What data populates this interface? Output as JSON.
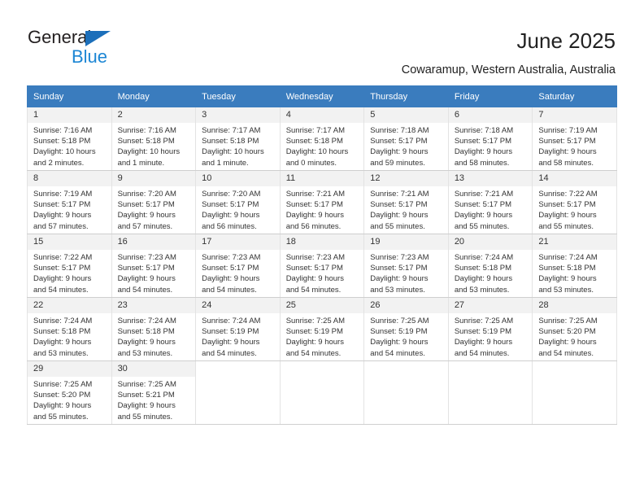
{
  "brand": {
    "name_part1": "General",
    "name_part2": "Blue",
    "triangle_color": "#1c6fba",
    "blue_text_color": "#1c86d4"
  },
  "header": {
    "title": "June 2025",
    "subtitle": "Cowaramup, Western Australia, Australia"
  },
  "theme": {
    "header_row_bg": "#3a7cbe",
    "header_row_text": "#ffffff",
    "daynum_bg": "#f2f2f2",
    "cell_border": "#e3e3e3"
  },
  "weekday_headers": [
    "Sunday",
    "Monday",
    "Tuesday",
    "Wednesday",
    "Thursday",
    "Friday",
    "Saturday"
  ],
  "weeks": [
    [
      {
        "day": "1",
        "sunrise": "Sunrise: 7:16 AM",
        "sunset": "Sunset: 5:18 PM",
        "daylight_line1": "Daylight: 10 hours",
        "daylight_line2": "and 2 minutes."
      },
      {
        "day": "2",
        "sunrise": "Sunrise: 7:16 AM",
        "sunset": "Sunset: 5:18 PM",
        "daylight_line1": "Daylight: 10 hours",
        "daylight_line2": "and 1 minute."
      },
      {
        "day": "3",
        "sunrise": "Sunrise: 7:17 AM",
        "sunset": "Sunset: 5:18 PM",
        "daylight_line1": "Daylight: 10 hours",
        "daylight_line2": "and 1 minute."
      },
      {
        "day": "4",
        "sunrise": "Sunrise: 7:17 AM",
        "sunset": "Sunset: 5:18 PM",
        "daylight_line1": "Daylight: 10 hours",
        "daylight_line2": "and 0 minutes."
      },
      {
        "day": "5",
        "sunrise": "Sunrise: 7:18 AM",
        "sunset": "Sunset: 5:17 PM",
        "daylight_line1": "Daylight: 9 hours",
        "daylight_line2": "and 59 minutes."
      },
      {
        "day": "6",
        "sunrise": "Sunrise: 7:18 AM",
        "sunset": "Sunset: 5:17 PM",
        "daylight_line1": "Daylight: 9 hours",
        "daylight_line2": "and 58 minutes."
      },
      {
        "day": "7",
        "sunrise": "Sunrise: 7:19 AM",
        "sunset": "Sunset: 5:17 PM",
        "daylight_line1": "Daylight: 9 hours",
        "daylight_line2": "and 58 minutes."
      }
    ],
    [
      {
        "day": "8",
        "sunrise": "Sunrise: 7:19 AM",
        "sunset": "Sunset: 5:17 PM",
        "daylight_line1": "Daylight: 9 hours",
        "daylight_line2": "and 57 minutes."
      },
      {
        "day": "9",
        "sunrise": "Sunrise: 7:20 AM",
        "sunset": "Sunset: 5:17 PM",
        "daylight_line1": "Daylight: 9 hours",
        "daylight_line2": "and 57 minutes."
      },
      {
        "day": "10",
        "sunrise": "Sunrise: 7:20 AM",
        "sunset": "Sunset: 5:17 PM",
        "daylight_line1": "Daylight: 9 hours",
        "daylight_line2": "and 56 minutes."
      },
      {
        "day": "11",
        "sunrise": "Sunrise: 7:21 AM",
        "sunset": "Sunset: 5:17 PM",
        "daylight_line1": "Daylight: 9 hours",
        "daylight_line2": "and 56 minutes."
      },
      {
        "day": "12",
        "sunrise": "Sunrise: 7:21 AM",
        "sunset": "Sunset: 5:17 PM",
        "daylight_line1": "Daylight: 9 hours",
        "daylight_line2": "and 55 minutes."
      },
      {
        "day": "13",
        "sunrise": "Sunrise: 7:21 AM",
        "sunset": "Sunset: 5:17 PM",
        "daylight_line1": "Daylight: 9 hours",
        "daylight_line2": "and 55 minutes."
      },
      {
        "day": "14",
        "sunrise": "Sunrise: 7:22 AM",
        "sunset": "Sunset: 5:17 PM",
        "daylight_line1": "Daylight: 9 hours",
        "daylight_line2": "and 55 minutes."
      }
    ],
    [
      {
        "day": "15",
        "sunrise": "Sunrise: 7:22 AM",
        "sunset": "Sunset: 5:17 PM",
        "daylight_line1": "Daylight: 9 hours",
        "daylight_line2": "and 54 minutes."
      },
      {
        "day": "16",
        "sunrise": "Sunrise: 7:23 AM",
        "sunset": "Sunset: 5:17 PM",
        "daylight_line1": "Daylight: 9 hours",
        "daylight_line2": "and 54 minutes."
      },
      {
        "day": "17",
        "sunrise": "Sunrise: 7:23 AM",
        "sunset": "Sunset: 5:17 PM",
        "daylight_line1": "Daylight: 9 hours",
        "daylight_line2": "and 54 minutes."
      },
      {
        "day": "18",
        "sunrise": "Sunrise: 7:23 AM",
        "sunset": "Sunset: 5:17 PM",
        "daylight_line1": "Daylight: 9 hours",
        "daylight_line2": "and 54 minutes."
      },
      {
        "day": "19",
        "sunrise": "Sunrise: 7:23 AM",
        "sunset": "Sunset: 5:17 PM",
        "daylight_line1": "Daylight: 9 hours",
        "daylight_line2": "and 53 minutes."
      },
      {
        "day": "20",
        "sunrise": "Sunrise: 7:24 AM",
        "sunset": "Sunset: 5:18 PM",
        "daylight_line1": "Daylight: 9 hours",
        "daylight_line2": "and 53 minutes."
      },
      {
        "day": "21",
        "sunrise": "Sunrise: 7:24 AM",
        "sunset": "Sunset: 5:18 PM",
        "daylight_line1": "Daylight: 9 hours",
        "daylight_line2": "and 53 minutes."
      }
    ],
    [
      {
        "day": "22",
        "sunrise": "Sunrise: 7:24 AM",
        "sunset": "Sunset: 5:18 PM",
        "daylight_line1": "Daylight: 9 hours",
        "daylight_line2": "and 53 minutes."
      },
      {
        "day": "23",
        "sunrise": "Sunrise: 7:24 AM",
        "sunset": "Sunset: 5:18 PM",
        "daylight_line1": "Daylight: 9 hours",
        "daylight_line2": "and 53 minutes."
      },
      {
        "day": "24",
        "sunrise": "Sunrise: 7:24 AM",
        "sunset": "Sunset: 5:19 PM",
        "daylight_line1": "Daylight: 9 hours",
        "daylight_line2": "and 54 minutes."
      },
      {
        "day": "25",
        "sunrise": "Sunrise: 7:25 AM",
        "sunset": "Sunset: 5:19 PM",
        "daylight_line1": "Daylight: 9 hours",
        "daylight_line2": "and 54 minutes."
      },
      {
        "day": "26",
        "sunrise": "Sunrise: 7:25 AM",
        "sunset": "Sunset: 5:19 PM",
        "daylight_line1": "Daylight: 9 hours",
        "daylight_line2": "and 54 minutes."
      },
      {
        "day": "27",
        "sunrise": "Sunrise: 7:25 AM",
        "sunset": "Sunset: 5:19 PM",
        "daylight_line1": "Daylight: 9 hours",
        "daylight_line2": "and 54 minutes."
      },
      {
        "day": "28",
        "sunrise": "Sunrise: 7:25 AM",
        "sunset": "Sunset: 5:20 PM",
        "daylight_line1": "Daylight: 9 hours",
        "daylight_line2": "and 54 minutes."
      }
    ],
    [
      {
        "day": "29",
        "sunrise": "Sunrise: 7:25 AM",
        "sunset": "Sunset: 5:20 PM",
        "daylight_line1": "Daylight: 9 hours",
        "daylight_line2": "and 55 minutes."
      },
      {
        "day": "30",
        "sunrise": "Sunrise: 7:25 AM",
        "sunset": "Sunset: 5:21 PM",
        "daylight_line1": "Daylight: 9 hours",
        "daylight_line2": "and 55 minutes."
      },
      {
        "day": "",
        "sunrise": "",
        "sunset": "",
        "daylight_line1": "",
        "daylight_line2": ""
      },
      {
        "day": "",
        "sunrise": "",
        "sunset": "",
        "daylight_line1": "",
        "daylight_line2": ""
      },
      {
        "day": "",
        "sunrise": "",
        "sunset": "",
        "daylight_line1": "",
        "daylight_line2": ""
      },
      {
        "day": "",
        "sunrise": "",
        "sunset": "",
        "daylight_line1": "",
        "daylight_line2": ""
      },
      {
        "day": "",
        "sunrise": "",
        "sunset": "",
        "daylight_line1": "",
        "daylight_line2": ""
      }
    ]
  ]
}
